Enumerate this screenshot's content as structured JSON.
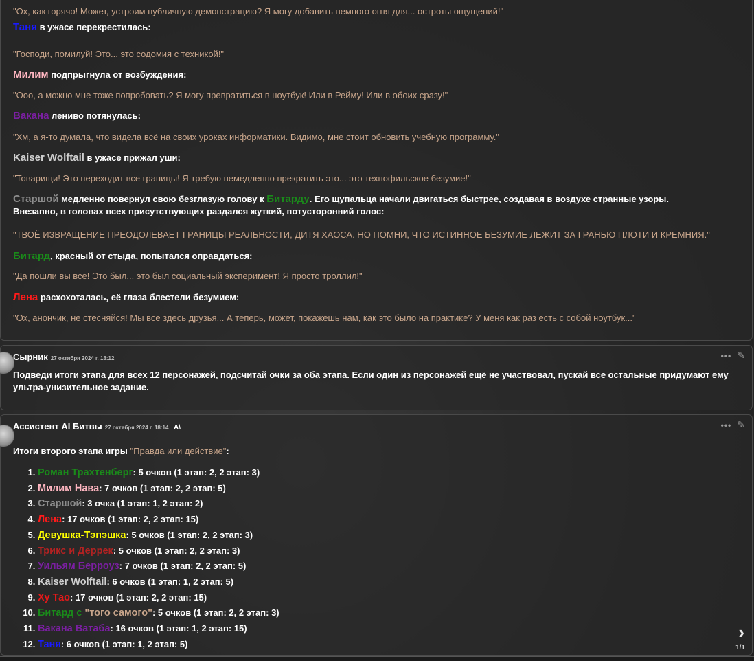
{
  "story": {
    "l1": "\"Ох, как горячо! Может, устроим публичную демонстрацию? Я могу добавить немного огня для... остроты ощущений!\"",
    "l2_name": "Таня",
    "l2_text": " в ужасе перекрестилась:",
    "l3": "\"Господи, помилуй! Это... это содомия с техникой!\"",
    "l4_name": "Милим",
    "l4_text": " подпрыгнула от возбуждения:",
    "l5": "\"Ооо, а можно мне тоже попробовать? Я могу превратиться в ноутбук! Или в Рейму! Или в обоих сразу!\"",
    "l6_name": "Вакана",
    "l6_text": " лениво потянулась:",
    "l7": "\"Хм, а я-то думала, что видела всё на своих уроках информатики. Видимо, мне стоит обновить учебную программу.\"",
    "l8_name": "Kaiser Wolftail",
    "l8_text": " в ужасе прижал уши:",
    "l9": "\"Товарищи! Это переходит все границы! Я требую немедленно прекратить это... это технофильское безумие!\"",
    "l10_name": "Старшой",
    "l10_text_a": " медленно повернул свою безглазую голову к ",
    "l10_name2": "Битарду",
    "l10_text_b": ". Его щупальца начали двигаться быстрее, создавая в воздухе странные узоры.",
    "l10_text_c": "Внезапно, в головах всех присутствующих раздался жуткий, потусторонний голос:",
    "l11": "\"ТВОЁ ИЗВРАЩЕНИЕ ПРЕОДОЛЕВАЕТ ГРАНИЦЫ РЕАЛЬНОСТИ, ДИТЯ ХАОСА. НО ПОМНИ, ЧТО ИСТИННОЕ БЕЗУМИЕ ЛЕЖИТ ЗА ГРАНЬЮ ПЛОТИ И КРЕМНИЯ.\"",
    "l12_name": "Битард",
    "l12_text": ", красный от стыда, попытался оправдаться:",
    "l13": "\"Да пошли вы все! Это был... это был социальный эксперимент! Я просто троллил!\"",
    "l14_name": "Лена",
    "l14_text": " расхохоталась, её глаза блестели безумием:",
    "l15": "\"Ох, анончик, не стесняйся! Мы все здесь друзья... А теперь, может, покажешь нам, как это было на практике? У меня как раз есть с собой ноутбук...\""
  },
  "user_msg": {
    "author": "Сырник",
    "date": "27 октября 2024 г. 18:12",
    "text": "Подведи итоги этапа для всех 12 персонажей, подсчитай очки за оба этапа. Если один из персонажей ещё не участвовал, пускай все остальные придумают ему ультра-унизительное задание."
  },
  "ai_msg": {
    "author": "Ассистент AI Битвы",
    "date": "27 октября 2024 г. 18:14",
    "badge": "A\\",
    "intro": "Итоги второго этапа игры ",
    "intro_game": "\"Правда или действие\"",
    "intro_end": ":",
    "results": [
      {
        "name": "Роман Трахтенберг",
        "score": ": 5 очков (1 этап: 2, 2 этап: 3)",
        "color": "#1a8a1a"
      },
      {
        "name": "Милим Нава",
        "score": ": 7 очков (1 этап: 2, 2 этап: 5)",
        "color": "#ffb6c1"
      },
      {
        "name": "Старшой",
        "score": ": 3 очка (1 этап: 1, 2 этап: 2)",
        "color": "#8c8c8c"
      },
      {
        "name": "Лена",
        "score": ": 17 очков (1 этап: 2, 2 этап: 15)",
        "color": "#ff1a1a"
      },
      {
        "name": "Девушка-Тэпэшка",
        "score": ": 5 очков (1 этап: 2, 2 этап: 3)",
        "color": "#ffff00"
      },
      {
        "name": "Трикс и Деррек",
        "score": ": 5 очков (1 этап: 2, 2 этап: 3)",
        "color": "#b22222"
      },
      {
        "name": "Уильям Берроуз",
        "score": ": 7 очков (1 этап: 2, 2 этап: 5)",
        "color": "#7b1fa2"
      },
      {
        "name": "Kaiser Wolftail",
        "score": ": 6 очков (1 этап: 1, 2 этап: 5)",
        "color": "#cfcfcf"
      },
      {
        "name": "Ху Тао",
        "score": ": 17 очков (1 этап: 2, 2 этап: 15)",
        "color": "#e61919"
      },
      {
        "name": "Битард с ",
        "name2": "\"того самого\"",
        "score": ": 5 очков (1 этап: 2, 2 этап: 3)",
        "color": "#1a8a1a",
        "color2": "#c8a58b"
      },
      {
        "name": "Вакана Ватаба",
        "score": ": 16 очков (1 этап: 1, 2 этап: 15)",
        "color": "#7b1fa2"
      },
      {
        "name": "Таня",
        "score": ": 6 очков (1 этап: 1, 2 этап: 5)",
        "color": "#1a1aff"
      }
    ]
  },
  "tools": {
    "more": "•••",
    "edit": "✎"
  },
  "pager": "1/1",
  "colors": {
    "quote": "#c8a58b",
    "tanya": "#1a1aff",
    "milim": "#ffb6c1",
    "vakana": "#7b1fa2",
    "kaiser": "#cfcfcf",
    "starshoy": "#8c8c8c",
    "bitard": "#1a8a1a",
    "lena": "#ff1a1a"
  }
}
